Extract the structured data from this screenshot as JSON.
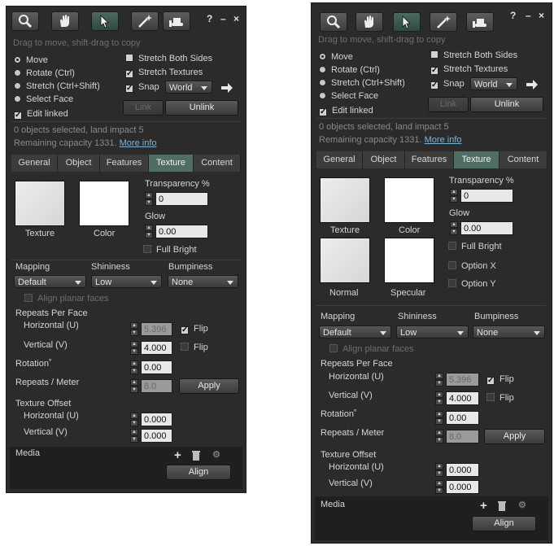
{
  "left": {
    "hint": "Drag to move, shift-drag to copy",
    "window_controls": [
      "?",
      "–",
      "×"
    ],
    "edit_modes": [
      "Move",
      "Rotate (Ctrl)",
      "Stretch (Ctrl+Shift)",
      "Select Face"
    ],
    "edit_linked": "Edit linked",
    "stretch_both": "Stretch Both Sides",
    "stretch_textures": "Stretch Textures",
    "snap": "Snap",
    "snap_value": "World",
    "link": "Link",
    "unlink": "Unlink",
    "status": "0 objects selected, land impact 5",
    "capacity": "Remaining capacity 1331.",
    "more_info": "More info",
    "tabs": [
      "General",
      "Object",
      "Features",
      "Texture",
      "Content"
    ],
    "texture_label": "Texture",
    "color_label": "Color",
    "transparency_label": "Transparency %",
    "transparency_value": "0",
    "glow_label": "Glow",
    "glow_value": "0.00",
    "full_bright": "Full Bright",
    "mapping_label": "Mapping",
    "shininess_label": "Shininess",
    "bumpiness_label": "Bumpiness",
    "mapping_value": "Default",
    "shininess_value": "Low",
    "bumpiness_value": "None",
    "align_planar": "Align planar faces",
    "repeats_per_face": "Repeats Per Face",
    "horizontal_u": "Horizontal (U)",
    "horizontal_value": "5.396",
    "vertical_v": "Vertical (V)",
    "vertical_value": "4.000",
    "flip": "Flip",
    "rotation_label": "Rotation˚",
    "rotation_value": "0.00",
    "repeats_meter": "Repeats / Meter",
    "repeats_meter_value": "8.0",
    "apply": "Apply",
    "texture_offset": "Texture Offset",
    "offset_h_value": "0.000",
    "offset_v_value": "0.000",
    "media": "Media",
    "align": "Align"
  },
  "right": {
    "hint": "Drag to move, shift-drag to copy",
    "window_controls": [
      "?",
      "–",
      "×"
    ],
    "edit_modes": [
      "Move",
      "Rotate (Ctrl)",
      "Stretch (Ctrl+Shift)",
      "Select Face"
    ],
    "edit_linked": "Edit linked",
    "stretch_both": "Stretch Both Sides",
    "stretch_textures": "Stretch Textures",
    "snap": "Snap",
    "snap_value": "World",
    "link": "Link",
    "unlink": "Unlink",
    "status": "0 objects selected, land impact 5",
    "capacity": "Remaining capacity 1331.",
    "more_info": "More info",
    "tabs": [
      "General",
      "Object",
      "Features",
      "Texture",
      "Content"
    ],
    "texture_label": "Texture",
    "color_label": "Color",
    "normal_label": "Normal",
    "specular_label": "Specular",
    "transparency_label": "Transparency %",
    "transparency_value": "0",
    "glow_label": "Glow",
    "glow_value": "0.00",
    "full_bright": "Full Bright",
    "option_x": "Option X",
    "option_y": "Option Y",
    "mapping_label": "Mapping",
    "shininess_label": "Shininess",
    "bumpiness_label": "Bumpiness",
    "mapping_value": "Default",
    "shininess_value": "Low",
    "bumpiness_value": "None",
    "align_planar": "Align planar faces",
    "repeats_per_face": "Repeats Per Face",
    "horizontal_u": "Horizontal (U)",
    "horizontal_value": "5.396",
    "vertical_v": "Vertical (V)",
    "vertical_value": "4.000",
    "flip": "Flip",
    "rotation_label": "Rotation˚",
    "rotation_value": "0.00",
    "repeats_meter": "Repeats / Meter",
    "repeats_meter_value": "8.0",
    "apply": "Apply",
    "texture_offset": "Texture Offset",
    "offset_h_value": "0.000",
    "offset_v_value": "0.000",
    "media": "Media",
    "align": "Align"
  },
  "colors": {
    "panel_bg": "#2b2b2b",
    "tab_selected": "#4f6d61",
    "link_color": "#7fb3d8"
  },
  "icons": [
    "magnifier-icon",
    "hand-icon",
    "pointer-icon",
    "wand-icon",
    "bulldozer-icon",
    "arrow-right-icon",
    "plus-icon",
    "trash-icon",
    "gear-icon"
  ]
}
